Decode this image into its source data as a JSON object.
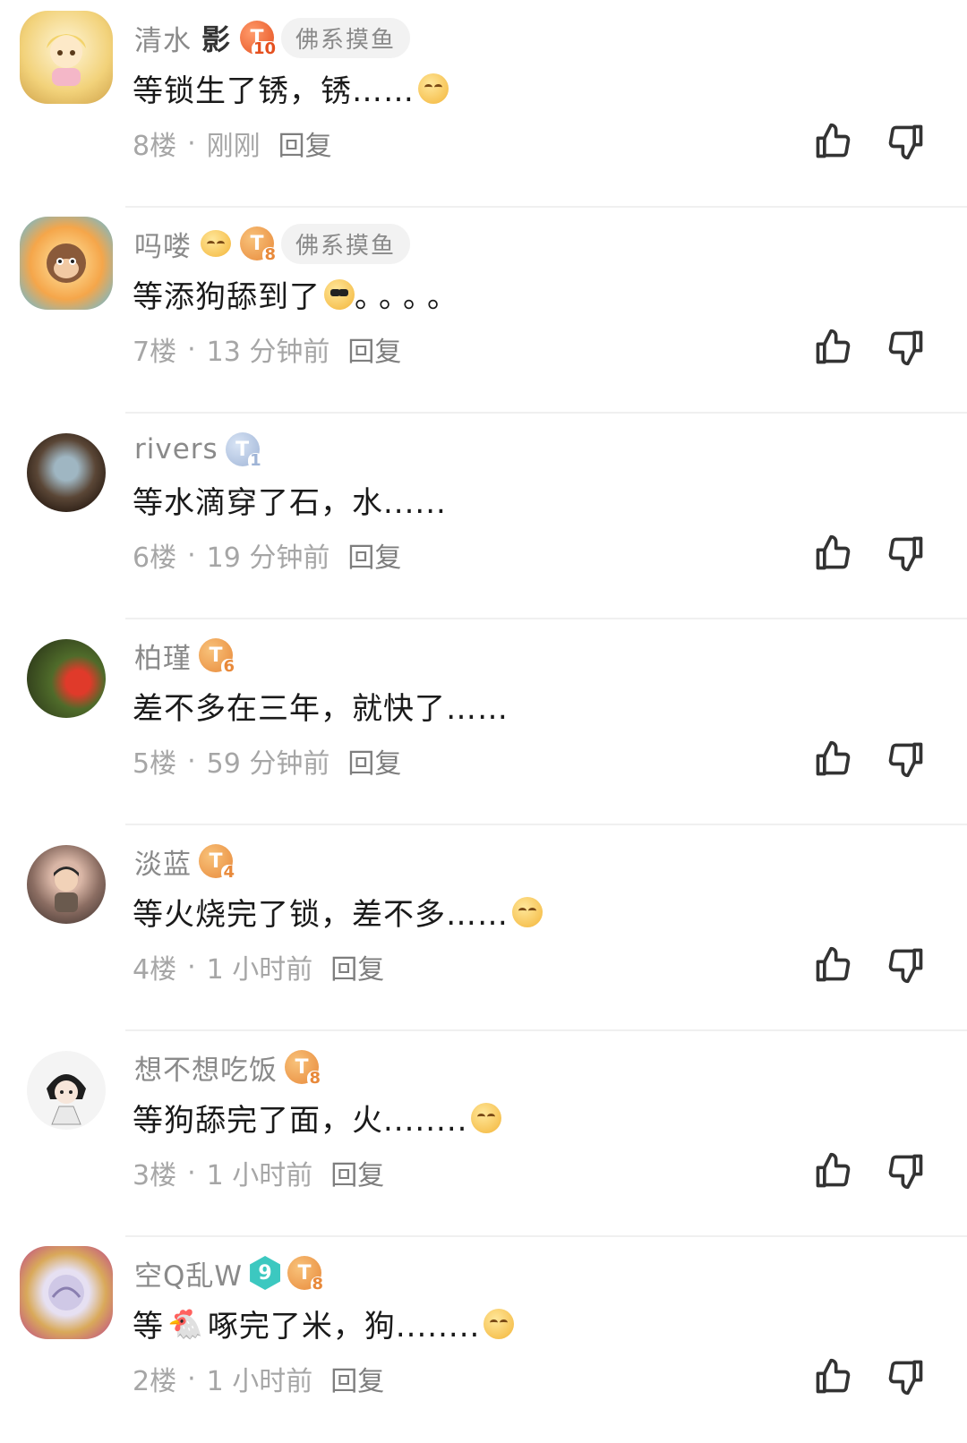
{
  "comments": [
    {
      "username": "清水",
      "name_emblem": "影",
      "level": "10",
      "level_style": "red",
      "tag": "佛系摸鱼",
      "content": "等锁生了锈，锈……",
      "content_emoji": "smile-emoji",
      "floor": "8楼",
      "time": "刚刚",
      "reply": "回复"
    },
    {
      "username": "吗喽",
      "name_emblem": "emoji",
      "level": "8",
      "level_style": "orange",
      "tag": "佛系摸鱼",
      "content": "等添狗舔到了",
      "content_emoji": "cool-emoji",
      "content_tail": "。。。。",
      "floor": "7楼",
      "time": "13 分钟前",
      "reply": "回复"
    },
    {
      "username": "rivers",
      "level": "1",
      "level_style": "blue",
      "content": "等水滴穿了石，水......",
      "floor": "6楼",
      "time": "19 分钟前",
      "reply": "回复"
    },
    {
      "username": "柏瑾",
      "level": "6",
      "level_style": "orange",
      "content": "差不多在三年，就快了……",
      "floor": "5楼",
      "time": "59 分钟前",
      "reply": "回复"
    },
    {
      "username": "淡蓝",
      "level": "4",
      "level_style": "orange",
      "content": "等火烧完了锁，差不多……",
      "content_emoji": "smile-emoji",
      "floor": "4楼",
      "time": "1 小时前",
      "reply": "回复"
    },
    {
      "username": "想不想吃饭",
      "level": "8",
      "level_style": "orange",
      "content": "等狗舔完了面，火........",
      "content_emoji": "smile-emoji",
      "floor": "3楼",
      "time": "1 小时前",
      "reply": "回复"
    },
    {
      "username": "空Q乱W",
      "vip": "9",
      "level": "8",
      "level_style": "orange",
      "content_pre": "等",
      "content": "啄完了米，狗........",
      "content_emoji": "smile-emoji",
      "floor": "2楼",
      "time": "1 小时前",
      "reply": "回复"
    }
  ],
  "icons": {
    "like": "thumbs-up-icon",
    "dislike": "thumbs-down-icon"
  },
  "colors": {
    "level_orange": "#e8893a",
    "level_red": "#e5501f",
    "level_blue": "#9fb4d6",
    "meta_gray": "#a6a6a6"
  }
}
